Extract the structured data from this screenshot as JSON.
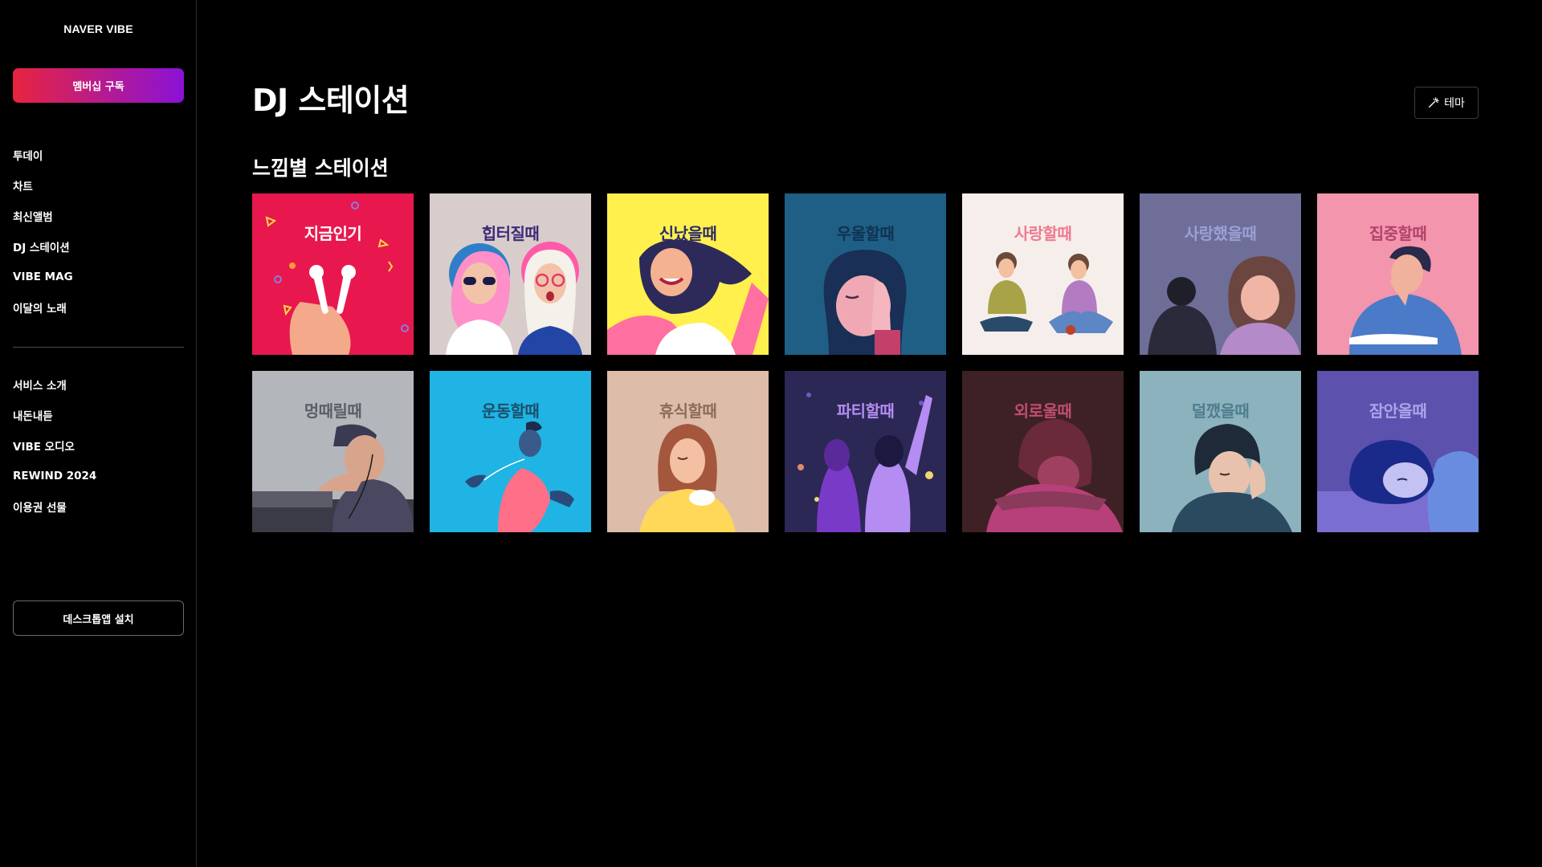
{
  "app": {
    "logo": "NAVER VIBE",
    "membership_label": "멤버십 구독",
    "desktop_install_label": "데스크톱앱 설치"
  },
  "sidebar": {
    "main_items": [
      {
        "label": "투데이"
      },
      {
        "label": "차트"
      },
      {
        "label": "최신앨범"
      },
      {
        "label": "DJ 스테이션"
      },
      {
        "label": "VIBE MAG"
      },
      {
        "label": "이달의 노래"
      }
    ],
    "sub_items": [
      {
        "label": "서비스 소개"
      },
      {
        "label": "내돈내듣"
      },
      {
        "label": "VIBE 오디오"
      },
      {
        "label": "REWIND 2024"
      },
      {
        "label": "이용권 선물"
      }
    ]
  },
  "main": {
    "title": "DJ 스테이션",
    "theme_label": "테마",
    "section_title": "느낌별 스테이션",
    "stations": [
      {
        "label": "지금인기",
        "bg": "#e8184e",
        "fg": "#ffffff",
        "icon": "earbuds-hand"
      },
      {
        "label": "힙터질때",
        "bg": "#d9cdcb",
        "fg": "#3b2a7a",
        "icon": "two-girls-sunglasses"
      },
      {
        "label": "신났을때",
        "bg": "#fff04e",
        "fg": "#2c2c6a",
        "icon": "girl-arms-up"
      },
      {
        "label": "우울할때",
        "bg": "#1f5f86",
        "fg": "#0f3352",
        "icon": "sad-face-hand"
      },
      {
        "label": "사랑할때",
        "bg": "#f6eeeb",
        "fg": "#f07a90",
        "icon": "couple-sitting"
      },
      {
        "label": "사랑했을때",
        "bg": "#6f6e98",
        "fg": "#9aa0d6",
        "icon": "couple-apart"
      },
      {
        "label": "집중할때",
        "bg": "#f295ad",
        "fg": "#b2436a",
        "icon": "man-reading"
      },
      {
        "label": "멍때릴때",
        "bg": "#b3b6bb",
        "fg": "#5c5e66",
        "icon": "man-headphones"
      },
      {
        "label": "운동할때",
        "bg": "#1fb4e3",
        "fg": "#1c4f6e",
        "icon": "runner"
      },
      {
        "label": "휴식할때",
        "bg": "#ddbcaa",
        "fg": "#8d6c5c",
        "icon": "woman-tea"
      },
      {
        "label": "파티할때",
        "bg": "#2c2855",
        "fg": "#b48cf2",
        "icon": "party-friends"
      },
      {
        "label": "외로울때",
        "bg": "#3e2124",
        "fg": "#c04d72",
        "icon": "lonely-head-down"
      },
      {
        "label": "덜깼을때",
        "bg": "#8cb2be",
        "fg": "#4f7d8d",
        "icon": "sleepy-man"
      },
      {
        "label": "잠안올때",
        "bg": "#5c51ad",
        "fg": "#a8a6ea",
        "icon": "sleepless-girl"
      }
    ]
  },
  "colors": {
    "background": "#000000",
    "membership_gradient_start": "#e8243f",
    "membership_gradient_end": "#8a12d6"
  }
}
